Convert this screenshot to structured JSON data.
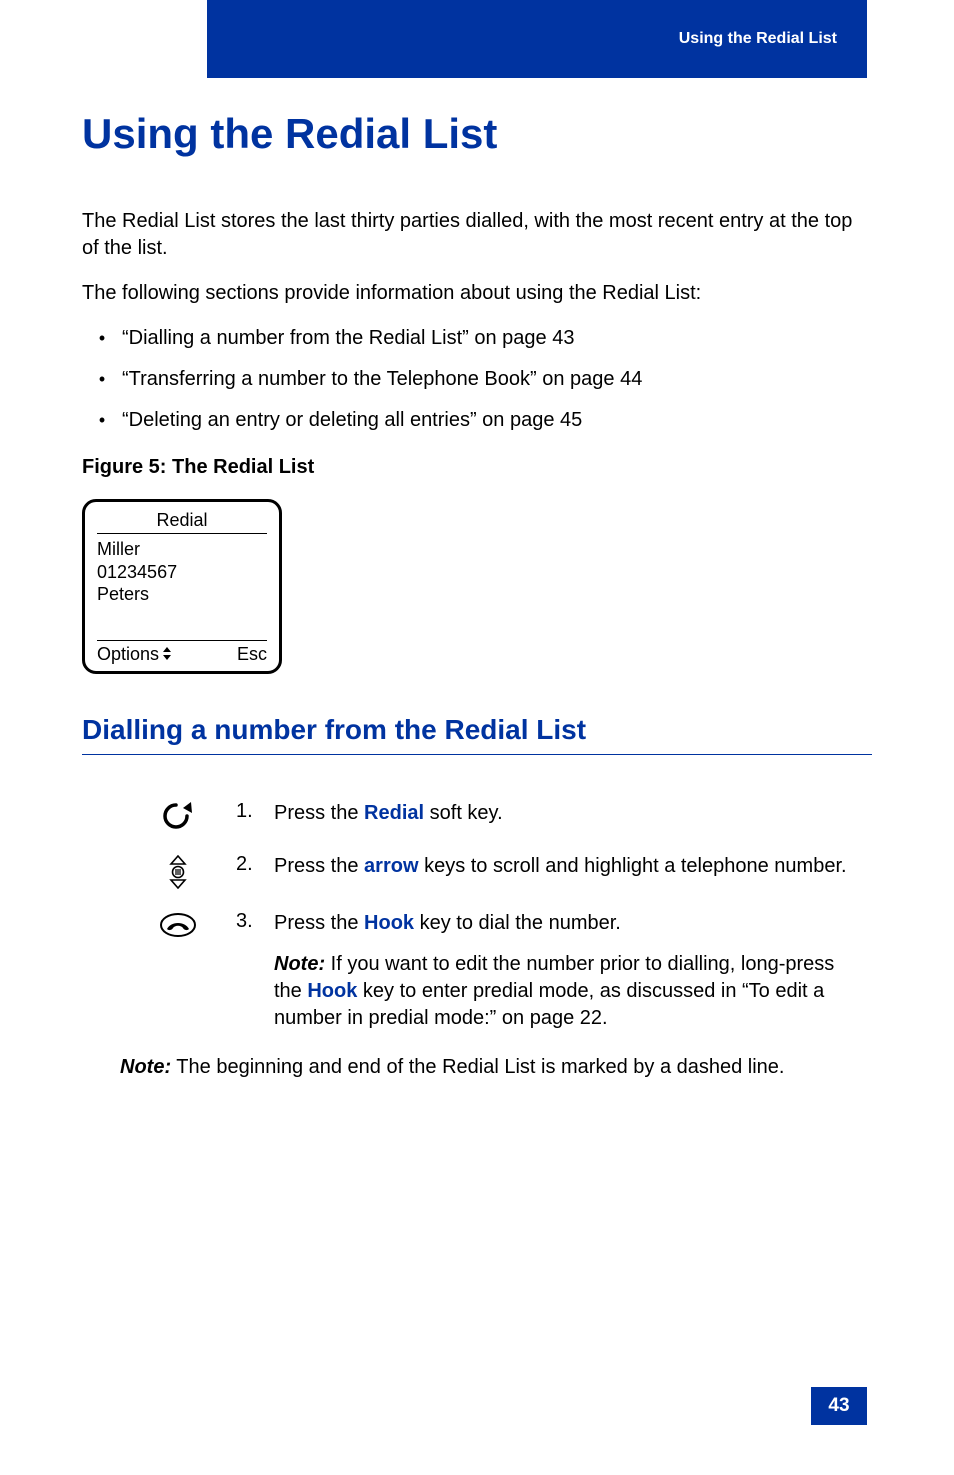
{
  "header": {
    "breadcrumb": "Using the Redial List"
  },
  "chapter_title": "Using the Redial List",
  "para1": "The Redial List stores the last thirty parties dialled, with the most recent entry at the top of the list.",
  "para2": "The following sections provide information about using the Redial List:",
  "bullets": [
    "“Dialling a number from the Redial List” on page 43",
    "“Transferring a number to the Telephone Book” on page 44",
    "“Deleting an entry or deleting all entries” on page 45"
  ],
  "figure_caption": "Figure 5: The Redial List",
  "phone_screen": {
    "title": "Redial",
    "lines": [
      "Miller",
      "01234567",
      "Peters"
    ],
    "left_soft": "Options",
    "right_soft": "Esc"
  },
  "section_title": "Dialling a number from the Redial List",
  "steps": [
    {
      "num": "1.",
      "pre": "Press the ",
      "kw": "Redial",
      "post": " soft key."
    },
    {
      "num": "2.",
      "pre": "Press the ",
      "kw": "arrow",
      "post": " keys to scroll and highlight a telephone number."
    },
    {
      "num": "3.",
      "pre": "Press the ",
      "kw": "Hook",
      "post": " key to dial the number."
    }
  ],
  "step3_note": {
    "label": "Note:",
    "pre": " If you want to edit the number prior to dialling, long-press the ",
    "kw": "Hook",
    "post": " key to enter predial mode, as discussed in “To edit a number in predial mode:” on page 22."
  },
  "bottom_note": {
    "label": "Note:",
    "text": " The beginning and end of the Redial List is marked by a dashed line."
  },
  "page_number": "43"
}
